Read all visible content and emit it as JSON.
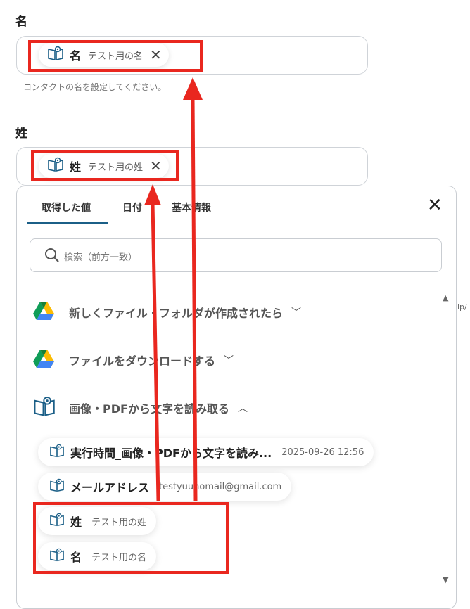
{
  "first_name": {
    "label": "名",
    "chip_key": "名",
    "chip_value": "テスト用の名",
    "hint": "コンタクトの名を設定してください。"
  },
  "last_name": {
    "label": "姓",
    "chip_key": "姓",
    "chip_value": "テスト用の姓"
  },
  "panel": {
    "tabs": [
      "取得した値",
      "日付",
      "基本情報"
    ],
    "search_placeholder": "検索（前方一致）",
    "groups": [
      {
        "title": "新しくファイル・フォルダが作成されたら",
        "icon": "google-drive-icon",
        "expanded": false
      },
      {
        "title": "ファイルをダウンロードする",
        "icon": "google-drive-icon",
        "expanded": false
      },
      {
        "title": "画像・PDFから文字を読み取る",
        "icon": "ocr-book-icon",
        "expanded": true
      }
    ],
    "items": [
      {
        "key": "実行時間_画像・PDFから文字を読み...",
        "value": "2025-09-26 12:56"
      },
      {
        "key": "メールアドレス",
        "value": "testyuunomail@gmail.com"
      },
      {
        "key": "姓",
        "value": "テスト用の姓"
      },
      {
        "key": "名",
        "value": "テスト用の名"
      }
    ]
  },
  "edge_text": "lp/",
  "colors": {
    "annotation_red": "#e9271f",
    "tab_accent": "#1b5f87"
  }
}
